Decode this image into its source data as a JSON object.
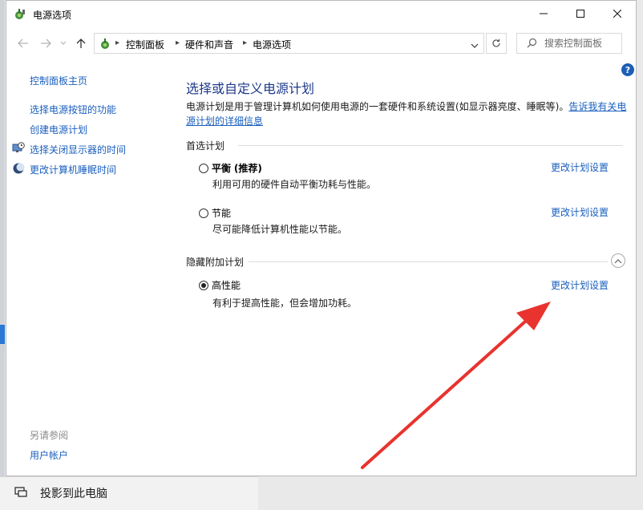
{
  "window": {
    "title": "电源选项"
  },
  "breadcrumb": [
    "控制面板",
    "硬件和声音",
    "电源选项"
  ],
  "search": {
    "placeholder": "搜索控制面板"
  },
  "help_label": "?",
  "sidebar": {
    "home": "控制面板主页",
    "items": [
      {
        "label": "选择电源按钮的功能",
        "icon": ""
      },
      {
        "label": "创建电源计划",
        "icon": ""
      },
      {
        "label": "选择关闭显示器的时间",
        "icon": "monitor-clock-icon"
      },
      {
        "label": "更改计算机睡眠时间",
        "icon": "moon-icon"
      }
    ],
    "see_also_title": "另请参阅",
    "see_also_items": [
      "用户帐户"
    ]
  },
  "main": {
    "title": "选择或自定义电源计划",
    "description": "电源计划是用于管理计算机如何使用电源的一套硬件和系统设置(如显示器亮度、睡眠等)。",
    "description_link": "告诉我有关电源计划的详细信息",
    "preferred_label": "首选计划",
    "hidden_label": "隐藏附加计划",
    "change_link_label": "更改计划设置",
    "plans": [
      {
        "name": "平衡",
        "tag": "(推荐)",
        "desc": "利用可用的硬件自动平衡功耗与性能。",
        "selected": false
      },
      {
        "name": "节能",
        "tag": "",
        "desc": "尽可能降低计算机性能以节能。",
        "selected": false
      },
      {
        "name": "高性能",
        "tag": "",
        "desc": "有利于提高性能，但会增加功耗。",
        "selected": true
      }
    ]
  },
  "background": {
    "taskbar_item": "投影到此电脑"
  },
  "colors": {
    "link": "#1a5fbe",
    "title": "#1d3a8a",
    "annotation_arrow": "#e8332e"
  }
}
